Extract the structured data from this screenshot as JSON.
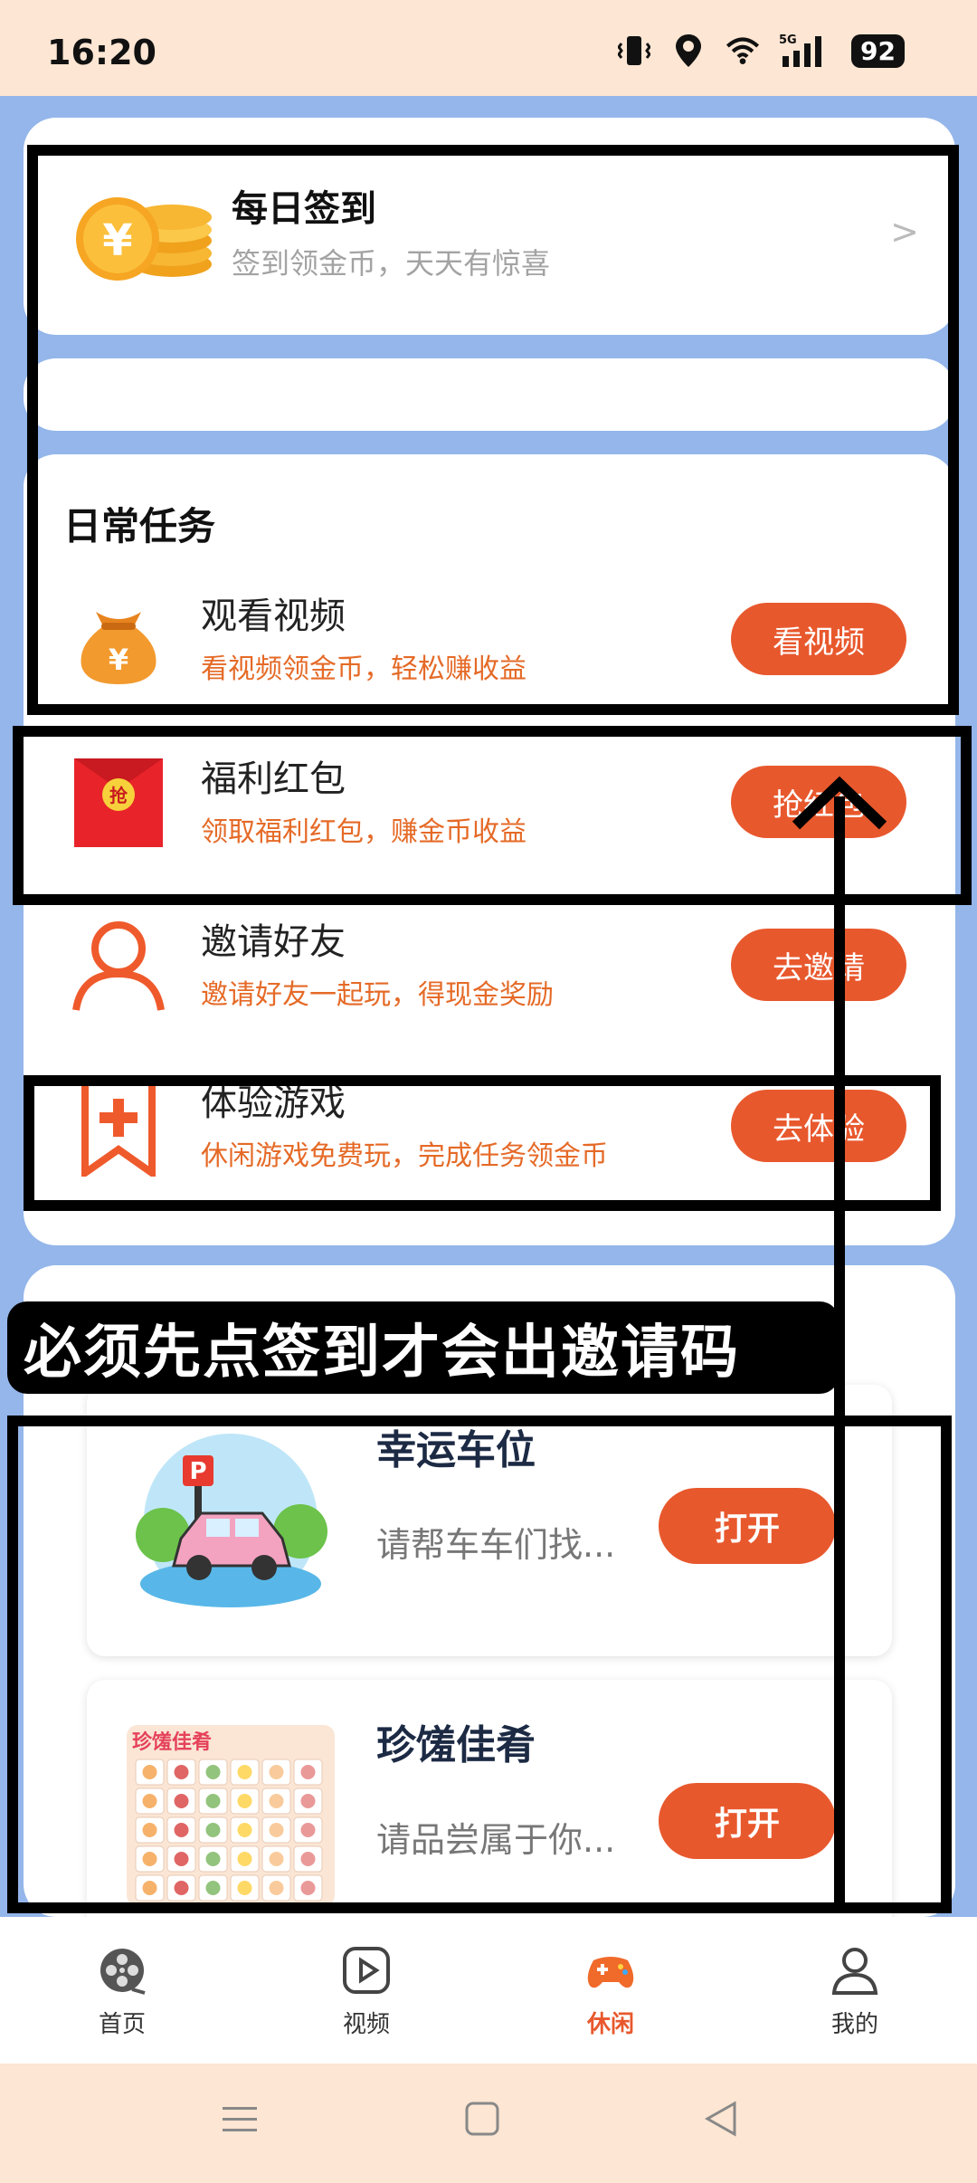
{
  "status_bar": {
    "time": "16:20",
    "network": "5G",
    "battery": "92"
  },
  "checkin": {
    "title": "每日签到",
    "subtitle": "签到领金币，天天有惊喜",
    "arrow": ">"
  },
  "tasks": {
    "section_title": "日常任务",
    "items": [
      {
        "name": "观看视频",
        "desc": "看视频领金币，轻松赚收益",
        "button": "看视频",
        "icon": "money-bag-icon"
      },
      {
        "name": "福利红包",
        "desc": "领取福利红包，赚金币收益",
        "button": "抢红包",
        "icon": "red-envelope-icon"
      },
      {
        "name": "邀请好友",
        "desc": "邀请好友一起玩，得现金奖励",
        "button": "去邀请",
        "icon": "person-icon"
      },
      {
        "name": "体验游戏",
        "desc": "休闲游戏免费玩，完成任务领金币",
        "button": "去体验",
        "icon": "bookmark-plus-icon"
      }
    ]
  },
  "annotation": {
    "text": "必须先点签到才会出邀请码"
  },
  "games": [
    {
      "name": "幸运车位",
      "desc": "请帮车车们找...",
      "button": "打开"
    },
    {
      "name": "珍馐佳肴",
      "desc": "请品尝属于你...",
      "button": "打开",
      "image_text": "珍馐佳肴"
    }
  ],
  "bottom_nav": [
    {
      "label": "首页",
      "icon": "film-reel-icon",
      "active": false
    },
    {
      "label": "视频",
      "icon": "play-square-icon",
      "active": false
    },
    {
      "label": "休闲",
      "icon": "gamepad-icon",
      "active": true
    },
    {
      "label": "我的",
      "icon": "user-icon",
      "active": false
    }
  ],
  "colors": {
    "accent": "#e8582d",
    "desc_orange": "#e56a27",
    "background": "#94b6ea",
    "status_bar": "#fde6d3"
  }
}
